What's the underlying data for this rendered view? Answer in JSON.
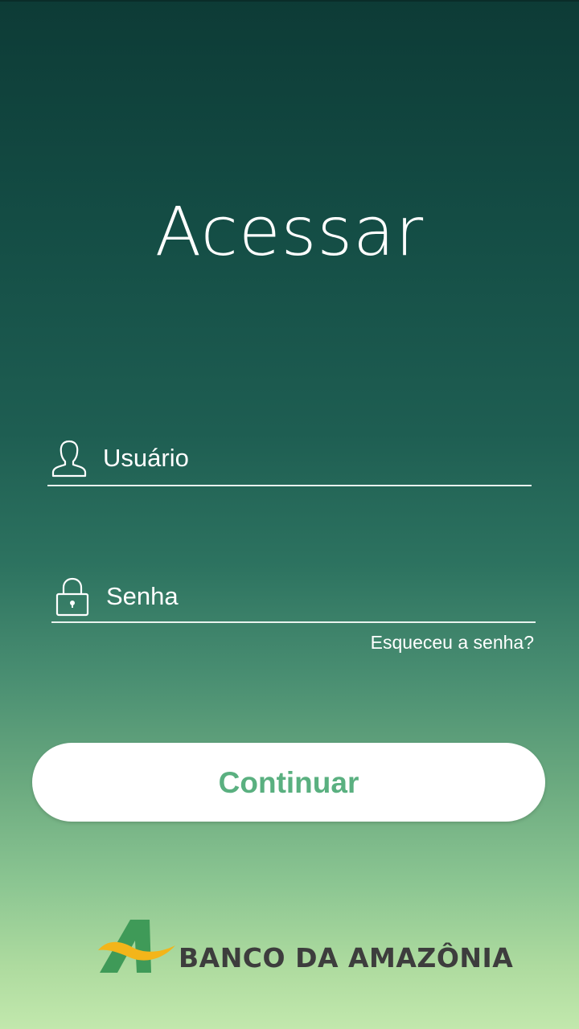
{
  "screen": {
    "title": "Acessar"
  },
  "form": {
    "user": {
      "placeholder": "Usuário",
      "value": "",
      "icon": "user-icon"
    },
    "password": {
      "placeholder": "Senha",
      "value": "",
      "icon": "lock-icon"
    },
    "forgot_password_label": "Esqueceu a senha?",
    "continue_label": "Continuar"
  },
  "brand": {
    "name": "BANCO DA AMAZÔNIA",
    "logo_icon": "banco-da-amazonia-logo",
    "accent_color": "#5ab080",
    "logo_green": "#3f9a58",
    "logo_yellow": "#f3b51a"
  }
}
